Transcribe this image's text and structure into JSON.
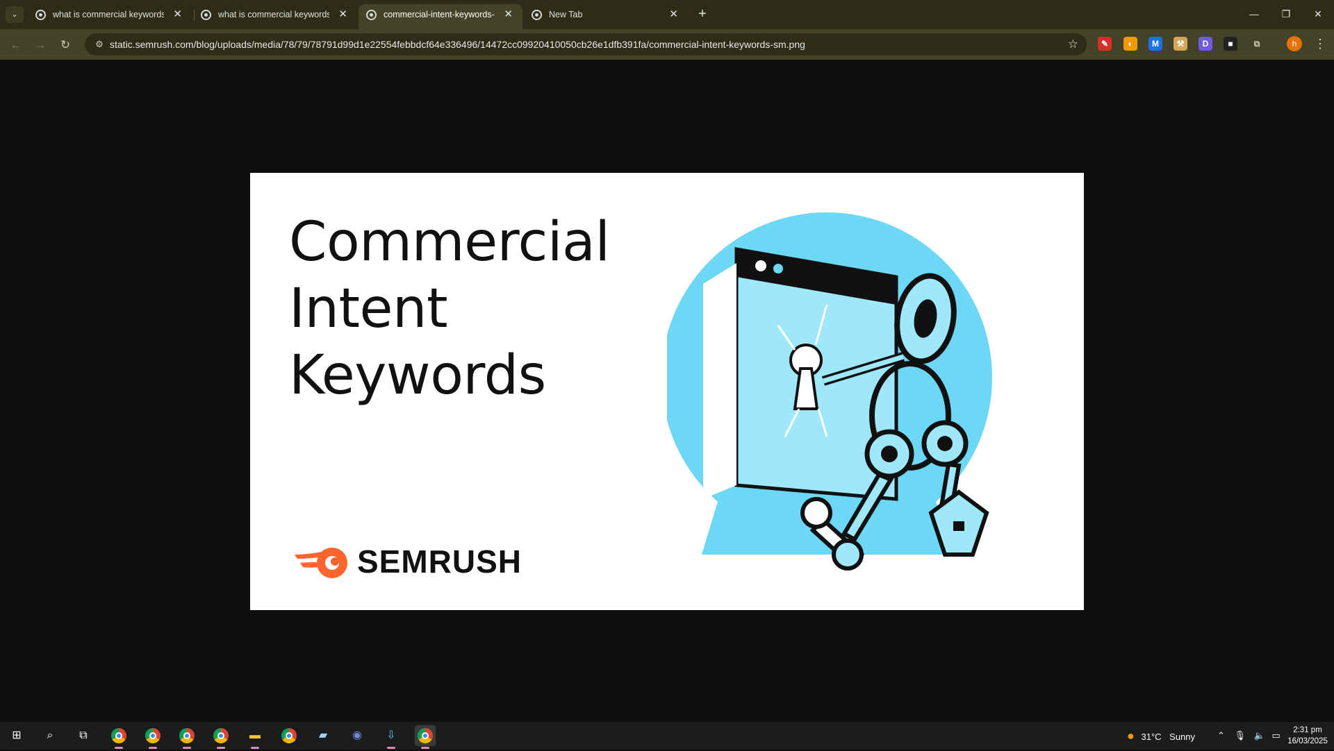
{
  "browser": {
    "tabs": [
      {
        "title": "what is commercial keywords -",
        "active": false
      },
      {
        "title": "what is commercial keywords -",
        "active": false
      },
      {
        "title": "commercial-intent-keywords-sm",
        "active": true
      },
      {
        "title": "New Tab",
        "active": false
      }
    ],
    "tab_close_glyph": "✕",
    "new_tab_glyph": "+",
    "window_controls": {
      "minimize": "—",
      "restore": "❐",
      "close": "✕"
    },
    "url": "static.semrush.com/blog/uploads/media/78/79/78791d99d1e22554febbdcf64e336496/14472cc09920410050cb26e1dfb391fa/commercial-intent-keywords-sm.png",
    "extensions": [
      {
        "icon": "red-pen-icon",
        "glyph": "✎",
        "color": "#d93025"
      },
      {
        "icon": "orange-circle-icon",
        "glyph": "◐",
        "color": "#f29900"
      },
      {
        "icon": "blue-m-icon",
        "glyph": "M",
        "color": "#1a73e8"
      },
      {
        "icon": "tools-icon",
        "glyph": "⚒",
        "color": "#d6a75a"
      },
      {
        "icon": "purple-d-icon",
        "glyph": "D",
        "color": "#6f5be0"
      },
      {
        "icon": "dark-square-icon",
        "glyph": "■",
        "color": "#222222"
      },
      {
        "icon": "puzzle-icon",
        "glyph": "⧉",
        "color": "#c8c8b8"
      }
    ],
    "profile_initial": "h"
  },
  "image": {
    "headline_lines": [
      "Commercial",
      "Intent",
      "Keywords"
    ],
    "brand_name": "SEMRUSH",
    "brand_color": "#ff642d",
    "accent_color": "#6cd8f5"
  },
  "taskbar": {
    "weather": {
      "temp": "31°C",
      "condition": "Sunny"
    },
    "clock": {
      "time": "2:31 pm",
      "date": "16/03/2025"
    }
  }
}
